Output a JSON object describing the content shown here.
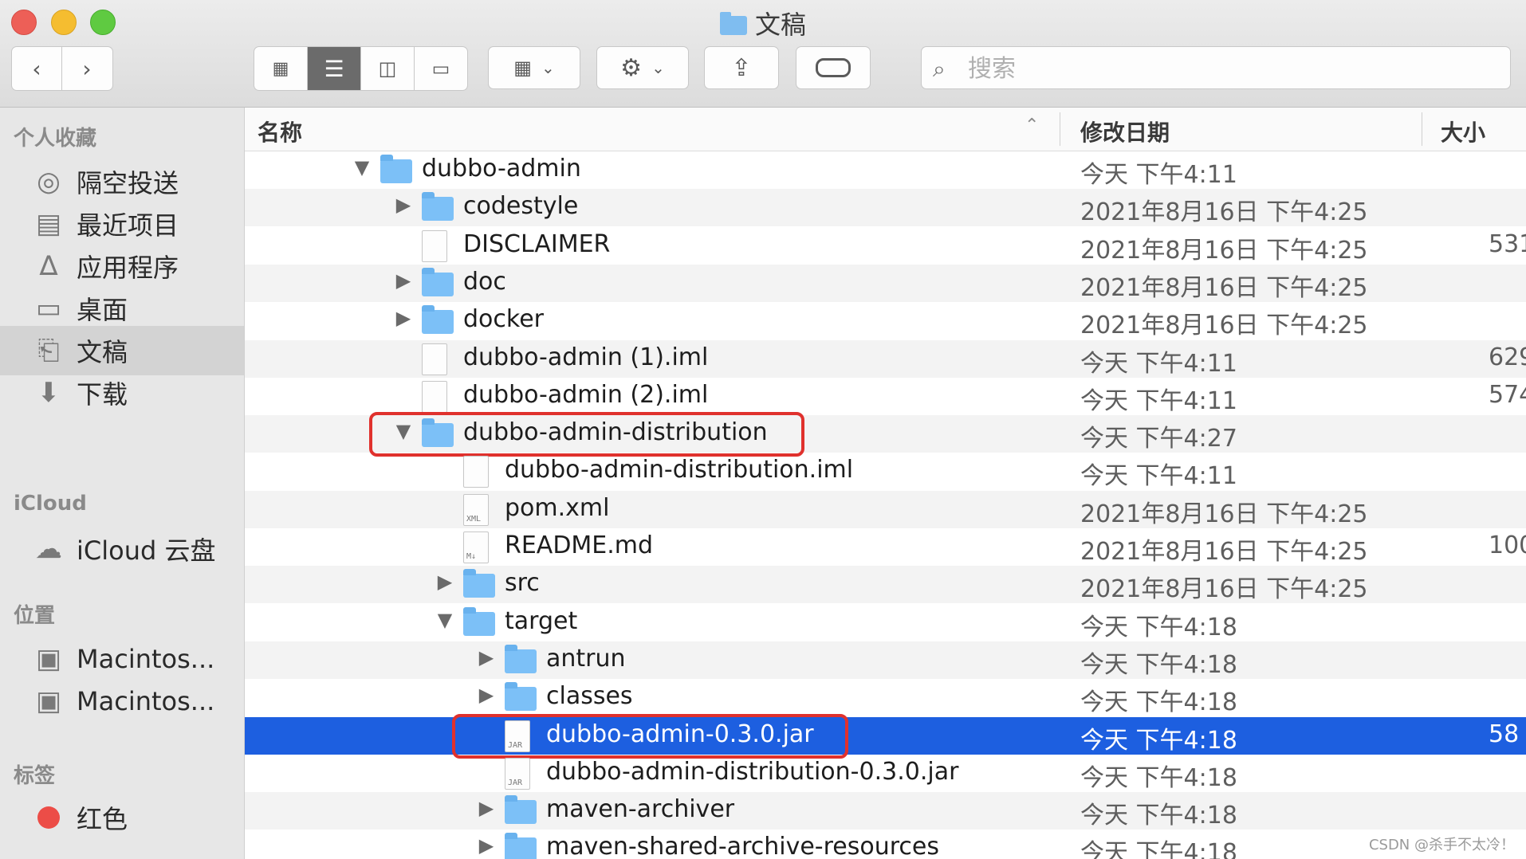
{
  "window": {
    "title": "文稿"
  },
  "toolbar": {
    "back_icon": "chevron-left-icon",
    "forward_icon": "chevron-right-icon",
    "view_modes": [
      "icon-view-icon",
      "list-view-icon",
      "column-view-icon",
      "gallery-view-icon"
    ],
    "active_view": "list-view-icon",
    "group_icon": "group-icon",
    "action_icon": "gear-icon",
    "share_icon": "share-icon",
    "tag_icon": "tag-icon",
    "search_placeholder": "搜索"
  },
  "sidebar": {
    "favorites_header": "个人收藏",
    "favorites": [
      {
        "label": "隔空投送",
        "icon": "airdrop-icon"
      },
      {
        "label": "最近项目",
        "icon": "recents-icon"
      },
      {
        "label": "应用程序",
        "icon": "applications-icon"
      },
      {
        "label": "桌面",
        "icon": "desktop-icon"
      },
      {
        "label": "文稿",
        "icon": "documents-icon",
        "selected": true
      },
      {
        "label": "下载",
        "icon": "downloads-icon"
      }
    ],
    "icloud_header": "iCloud",
    "icloud": [
      {
        "label": "iCloud 云盘",
        "icon": "cloud-icon"
      }
    ],
    "locations_header": "位置",
    "locations": [
      {
        "label": "Macintos...",
        "icon": "disk-icon"
      },
      {
        "label": "Macintos...",
        "icon": "disk-icon"
      }
    ],
    "tags_header": "标签",
    "tags": [
      {
        "label": "红色",
        "color": "#ec4d47"
      }
    ]
  },
  "columns": {
    "name": "名称",
    "modified": "修改日期",
    "size": "大小"
  },
  "files": [
    {
      "name": "dubbo-admin",
      "type": "folder",
      "depth": 0,
      "expanded": true,
      "date": "今天 下午4:11",
      "size": ""
    },
    {
      "name": "codestyle",
      "type": "folder",
      "depth": 1,
      "expanded": false,
      "date": "2021年8月16日 下午4:25",
      "size": ""
    },
    {
      "name": "DISCLAIMER",
      "type": "file",
      "depth": 1,
      "date": "2021年8月16日 下午4:25",
      "size": "531"
    },
    {
      "name": "doc",
      "type": "folder",
      "depth": 1,
      "expanded": false,
      "date": "2021年8月16日 下午4:25",
      "size": ""
    },
    {
      "name": "docker",
      "type": "folder",
      "depth": 1,
      "expanded": false,
      "date": "2021年8月16日 下午4:25",
      "size": ""
    },
    {
      "name": "dubbo-admin (1).iml",
      "type": "file",
      "depth": 1,
      "date": "今天 下午4:11",
      "size": "629"
    },
    {
      "name": "dubbo-admin (2).iml",
      "type": "file",
      "depth": 1,
      "date": "今天 下午4:11",
      "size": "574"
    },
    {
      "name": "dubbo-admin-distribution",
      "type": "folder",
      "depth": 1,
      "expanded": true,
      "date": "今天 下午4:27",
      "size": "",
      "highlighted": true
    },
    {
      "name": "dubbo-admin-distribution.iml",
      "type": "file",
      "depth": 2,
      "date": "今天 下午4:11",
      "size": ""
    },
    {
      "name": "pom.xml",
      "type": "xml",
      "depth": 2,
      "date": "2021年8月16日 下午4:25",
      "size": ""
    },
    {
      "name": "README.md",
      "type": "md",
      "depth": 2,
      "date": "2021年8月16日 下午4:25",
      "size": "100"
    },
    {
      "name": "src",
      "type": "folder",
      "depth": 2,
      "expanded": false,
      "date": "2021年8月16日 下午4:25",
      "size": ""
    },
    {
      "name": "target",
      "type": "folder",
      "depth": 2,
      "expanded": true,
      "date": "今天 下午4:18",
      "size": ""
    },
    {
      "name": "antrun",
      "type": "folder",
      "depth": 3,
      "expanded": false,
      "date": "今天 下午4:18",
      "size": ""
    },
    {
      "name": "classes",
      "type": "folder",
      "depth": 3,
      "expanded": false,
      "date": "今天 下午4:18",
      "size": ""
    },
    {
      "name": "dubbo-admin-0.3.0.jar",
      "type": "jar",
      "depth": 3,
      "date": "今天 下午4:18",
      "size": "58",
      "selected": true,
      "highlighted": true
    },
    {
      "name": "dubbo-admin-distribution-0.3.0.jar",
      "type": "jar",
      "depth": 3,
      "date": "今天 下午4:18",
      "size": ""
    },
    {
      "name": "maven-archiver",
      "type": "folder",
      "depth": 3,
      "expanded": false,
      "date": "今天 下午4:18",
      "size": ""
    },
    {
      "name": "maven-shared-archive-resources",
      "type": "folder",
      "depth": 3,
      "expanded": false,
      "date": "今天 下午4:18",
      "size": ""
    }
  ],
  "watermark": "CSDN @杀手不太冷！"
}
